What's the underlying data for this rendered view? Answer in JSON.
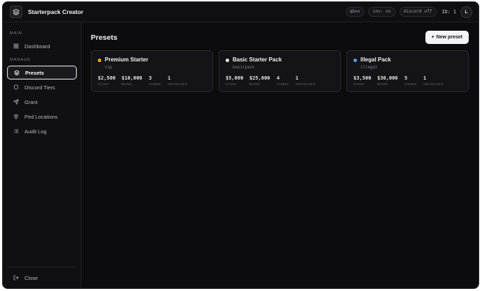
{
  "app": {
    "title": "Starterpack Creator",
    "chips": [
      "qbox",
      "inv: ox",
      "discord off"
    ],
    "id_label": "ID: 1",
    "avatar_initial": "L"
  },
  "sidebar": {
    "sections": [
      {
        "label": "MAIN",
        "items": [
          {
            "label": "Dashboard",
            "icon": "dashboard-icon"
          }
        ]
      },
      {
        "label": "MANAGE",
        "items": [
          {
            "label": "Presets",
            "icon": "layers-icon",
            "active": true
          },
          {
            "label": "Discord Tiers",
            "icon": "shield-icon"
          },
          {
            "label": "Grant",
            "icon": "send-icon"
          },
          {
            "label": "Ped Locations",
            "icon": "map-pin-icon"
          },
          {
            "label": "Audit Log",
            "icon": "list-icon"
          }
        ]
      }
    ],
    "close_label": "Close"
  },
  "main": {
    "title": "Presets",
    "new_button": "New preset",
    "new_button_icon": "+",
    "presets": [
      {
        "name": "Premium Starter",
        "tag": "vip",
        "color": "#f5a623",
        "stats": [
          {
            "value": "$2,500",
            "label": "CASH"
          },
          {
            "value": "$10,000",
            "label": "BANK"
          },
          {
            "value": "3",
            "label": "ITEMS"
          },
          {
            "value": "1",
            "label": "VEHICLES"
          }
        ]
      },
      {
        "name": "Basic Starter Pack",
        "tag": "basicpack",
        "color": "#f2f2f2",
        "stats": [
          {
            "value": "$5,000",
            "label": "CASH"
          },
          {
            "value": "$25,000",
            "label": "BANK"
          },
          {
            "value": "4",
            "label": "ITEMS"
          },
          {
            "value": "1",
            "label": "VEHICLES"
          }
        ]
      },
      {
        "name": "Illegal Pack",
        "tag": "illegal",
        "color": "#5b9cf5",
        "stats": [
          {
            "value": "$3,500",
            "label": "CASH"
          },
          {
            "value": "$30,000",
            "label": "BANK"
          },
          {
            "value": "5",
            "label": "ITEMS"
          },
          {
            "value": "1",
            "label": "VEHICLES"
          }
        ]
      }
    ]
  }
}
